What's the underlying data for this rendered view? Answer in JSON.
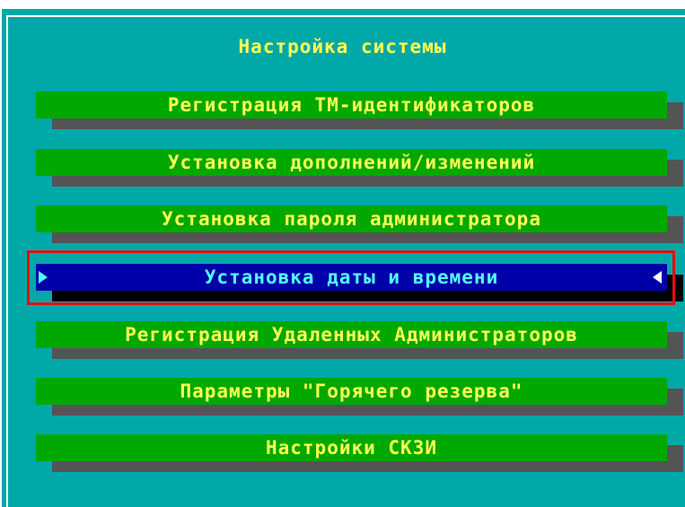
{
  "window": {
    "title": "Настройка системы"
  },
  "menu": {
    "items": [
      {
        "label": "Регистрация ТМ-идентификаторов",
        "selected": false
      },
      {
        "label": "Установка дополнений/изменений",
        "selected": false
      },
      {
        "label": "Установка пароля администратора",
        "selected": false
      },
      {
        "label": "Установка даты и времени",
        "selected": true
      },
      {
        "label": "Регистрация Удаленных Администраторов",
        "selected": false
      },
      {
        "label": "Параметры \"Горячего резерва\"",
        "selected": false
      },
      {
        "label": "Настройки СКЗИ",
        "selected": false
      }
    ]
  },
  "colors": {
    "background": "#00a8a8",
    "item_bar": "#00a800",
    "item_text": "#ffff54",
    "selected_bar": "#0000a8",
    "selected_text": "#54ffff",
    "shadow": "#545454",
    "highlight_border": "#e01010"
  },
  "icons": {
    "selection_left": "triangle-right-icon",
    "selection_right": "triangle-left-icon"
  }
}
